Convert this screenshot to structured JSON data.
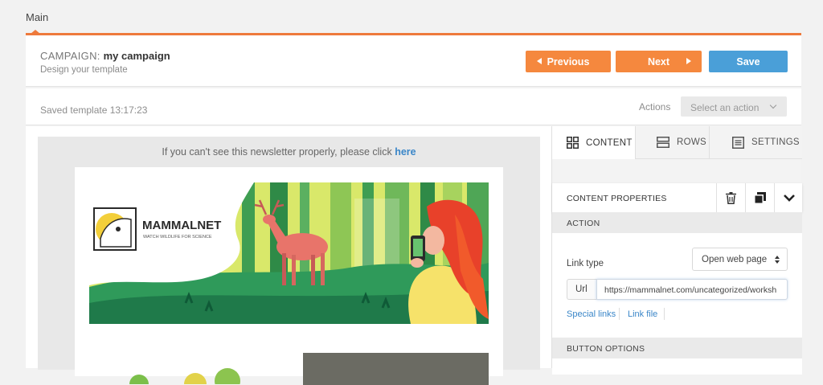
{
  "tabs": {
    "main": "Main"
  },
  "header": {
    "campaign_prefix": "CAMPAIGN:",
    "campaign_name": "my campaign",
    "subtitle": "Design your template",
    "previous_label": "Previous",
    "next_label": "Next",
    "save_label": "Save"
  },
  "status": {
    "saved_text": "Saved template 13:17:23",
    "actions_label": "Actions",
    "select_action": "Select an action"
  },
  "email": {
    "view_note": "If you can't see this newsletter properly, please click",
    "view_link": "here",
    "brand_name": "MAMMALNET",
    "brand_tagline": "WATCH WILDLIFE FOR SCIENCE"
  },
  "panel": {
    "tabs": {
      "content": "CONTENT",
      "rows": "ROWS",
      "settings": "SETTINGS"
    },
    "content_properties": "CONTENT PROPERTIES",
    "action_label": "ACTION",
    "link_type_label": "Link type",
    "link_type_value": "Open web page",
    "url_label": "Url",
    "url_value": "https://mammalnet.com/uncategorized/worksh",
    "special_links": "Special links",
    "link_file": "Link file",
    "button_options_label": "BUTTON OPTIONS"
  },
  "colors": {
    "accent_orange": "#f5883e",
    "save_blue": "#4a9fd8",
    "link_blue": "#3a86c8"
  }
}
